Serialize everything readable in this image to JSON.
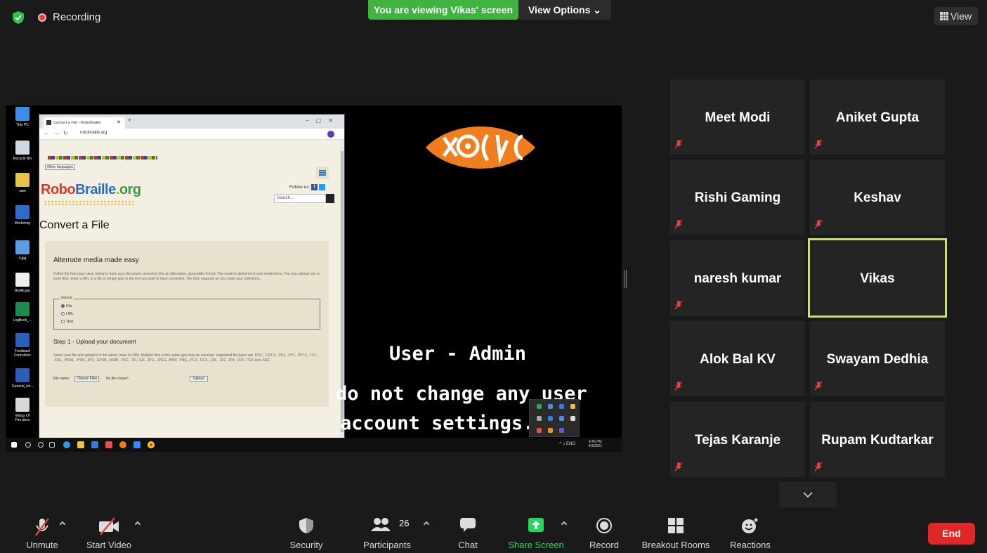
{
  "topbar": {
    "recording_label": "Recording",
    "viewing_banner": "You are viewing Vikas' screen",
    "view_options": "View Options ⌄",
    "view_button": "View"
  },
  "shared_screen": {
    "desktop_icons": [
      "This PC",
      "Recycle Bin",
      "sam",
      "Workshop",
      "4.jpg",
      "Braille.jpg",
      "LogBook_...",
      "Feedback Form.docx",
      "General_Inf...",
      "Wings Of Fire.docx"
    ],
    "browser": {
      "tab_title": "Convert a File - RoboBraille",
      "url": "robobraille.org",
      "other_languages": "Other languages",
      "logo_text": [
        "Robo",
        "Braille",
        ".",
        "org"
      ],
      "follow_us": "Follow us:",
      "search_placeholder": "Search...",
      "page_heading": "Convert a File",
      "panel_title": "Alternate media made easy",
      "panel_desc": "Follow the four easy steps below to have your document converted into an alternative, accessible format. The result is delivered in your email inbox. You may upload one or more files, enter a URL to a file or simply type in the text you wish to have converted. The form expands as you make your selections.",
      "source_legend": "Source",
      "source_options": [
        "File",
        "URL",
        "Text"
      ],
      "step1_title": "Step 1 - Upload your document",
      "step1_desc": "Select your file and upload it to the server (max 64 MB). Multiple files of the same type may be selected. Supported file types are .DOC, .DOCX, .PDF, .PPT, .PPTX, .TXT, .XML, .HTML, .HTM, .RTF, .EPUB, .MOBI, .TIFF, .TIF, .GIF, .JPG, .JPEG, .BMP, .PNG, .PCX, .DCX, .J2K, .JP2, .JPX, .DJV, .TEX and .ASC",
      "file_name_label": "File name:",
      "choose_files": "Choose Files",
      "no_file": "No file chosen",
      "upload": "Upload"
    },
    "overlay_text": {
      "line1": "User - Admin",
      "line2": "do not change any user",
      "line3": "account settings."
    },
    "taskbar": {
      "lang": "^ ⌂ ENG",
      "time": "4:45 PM",
      "date": "4/3/2021"
    }
  },
  "participants": [
    {
      "name": "Meet Modi",
      "muted": true,
      "active": false
    },
    {
      "name": "Aniket Gupta",
      "muted": true,
      "active": false
    },
    {
      "name": "Rishi Gaming",
      "muted": true,
      "active": false
    },
    {
      "name": "Keshav",
      "muted": true,
      "active": false
    },
    {
      "name": "naresh kumar",
      "muted": true,
      "active": false
    },
    {
      "name": "Vikas",
      "muted": false,
      "active": true
    },
    {
      "name": "Alok Bal KV",
      "muted": true,
      "active": false
    },
    {
      "name": "Swayam Dedhia",
      "muted": true,
      "active": false
    },
    {
      "name": "Tejas Karanje",
      "muted": true,
      "active": false
    },
    {
      "name": "Rupam Kudtarkar",
      "muted": true,
      "active": false
    }
  ],
  "controls": {
    "unmute": "Unmute",
    "start_video": "Start Video",
    "security": "Security",
    "participants": "Participants",
    "participant_count": "26",
    "chat": "Chat",
    "share_screen": "Share Screen",
    "record": "Record",
    "breakout_rooms": "Breakout Rooms",
    "reactions": "Reactions",
    "end": "End"
  },
  "colors": {
    "banner_green": "#3fb33f",
    "share_green": "#23d959",
    "end_red": "#e02828",
    "active_speaker": "#c3e36b",
    "mute_red": "#e04242"
  }
}
